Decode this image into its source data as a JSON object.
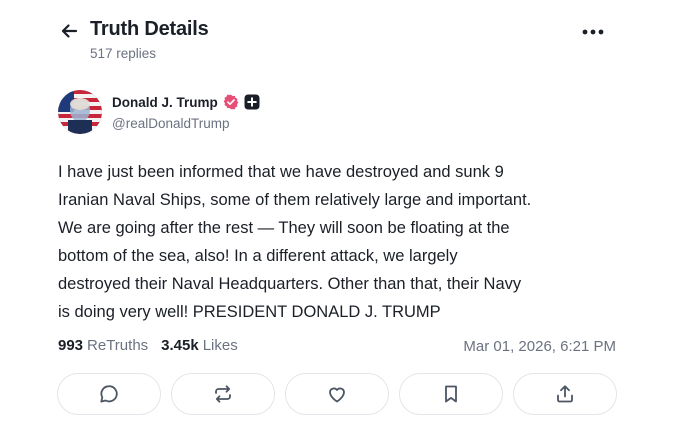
{
  "header": {
    "title": "Truth Details",
    "subtitle": "517 replies",
    "back_icon": "arrow-left-icon",
    "more_icon": "ellipsis-icon"
  },
  "post": {
    "author": {
      "name": "Donald J. Trump",
      "handle": "@realDonaldTrump",
      "verified_color": "#e84f77"
    },
    "text": "I have just been informed that we have destroyed and sunk 9\nIranian Naval Ships, some of them relatively large and important.\nWe are going after the rest — They will soon be floating at the\nbottom of the sea, also! In a different attack, we largely\ndestroyed their Naval Headquarters. Other than that, their Navy\nis doing very well! PRESIDENT DONALD J. TRUMP",
    "retruths_count": "993",
    "retruths_label": "ReTruths",
    "likes_count": "3.45k",
    "likes_label": "Likes",
    "timestamp": "Mar 01, 2026, 6:21 PM"
  },
  "actions": [
    {
      "name": "reply",
      "icon": "chat-bubble-icon"
    },
    {
      "name": "retruth",
      "icon": "repost-icon"
    },
    {
      "name": "like",
      "icon": "heart-icon"
    },
    {
      "name": "bookmark",
      "icon": "bookmark-icon"
    },
    {
      "name": "share",
      "icon": "share-upload-icon"
    }
  ]
}
